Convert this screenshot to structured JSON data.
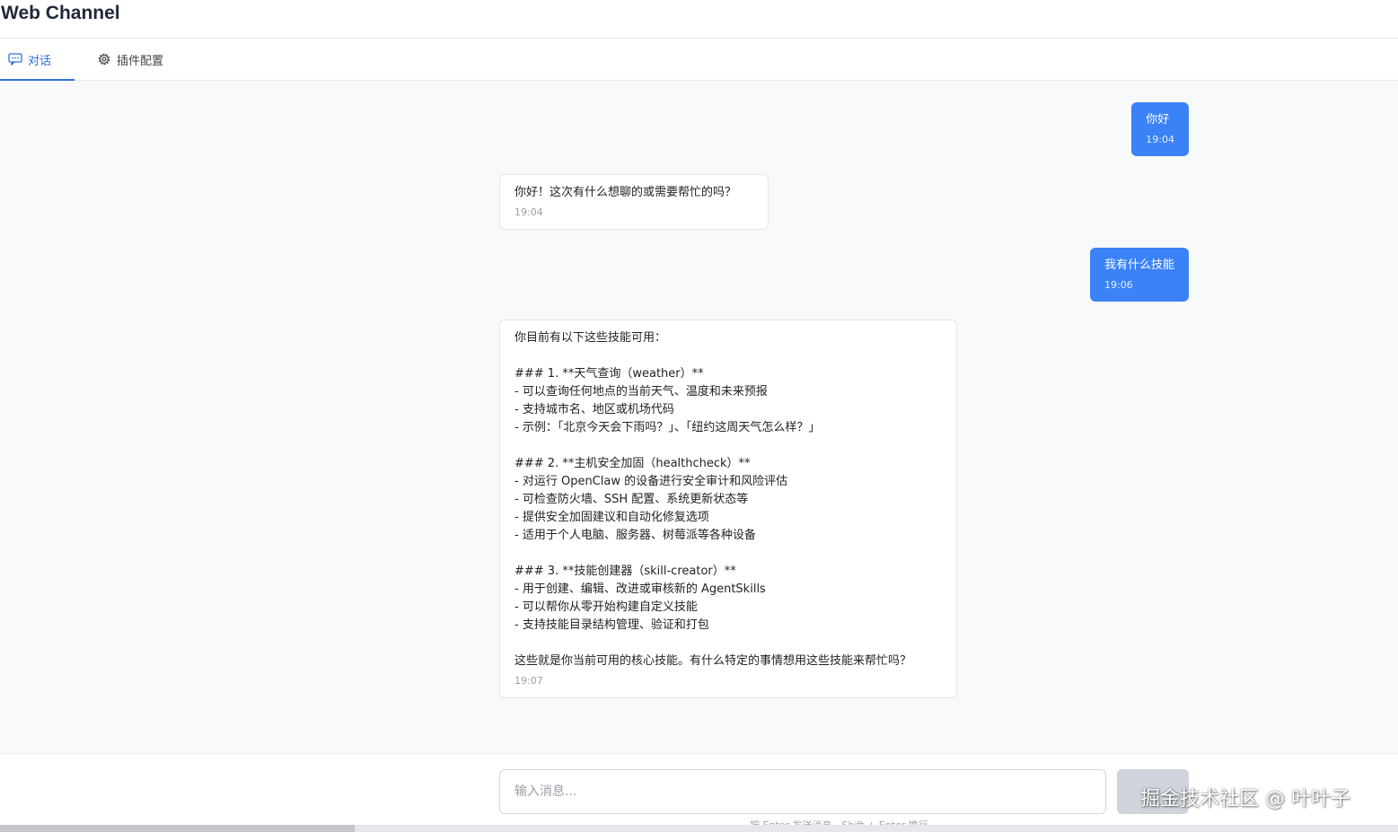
{
  "header": {
    "title": "Web Channel"
  },
  "tabs": [
    {
      "label": "对话",
      "icon": "chat-bubble-icon",
      "active": true
    },
    {
      "label": "插件配置",
      "icon": "gear-icon",
      "active": false
    }
  ],
  "messages": [
    {
      "role": "user",
      "text": "你好",
      "time": "19:04"
    },
    {
      "role": "assistant",
      "text": "你好！这次有什么想聊的或需要帮忙的吗？",
      "time": "19:04"
    },
    {
      "role": "user",
      "text": "我有什么技能",
      "time": "19:06"
    },
    {
      "role": "assistant",
      "text": "你目前有以下这些技能可用：\n\n### 1. **天气查询（weather）**\n- 可以查询任何地点的当前天气、温度和未来预报\n- 支持城市名、地区或机场代码\n- 示例：「北京今天会下雨吗？」、「纽约这周天气怎么样？」\n\n### 2. **主机安全加固（healthcheck）**\n- 对运行 OpenClaw 的设备进行安全审计和风险评估\n- 可检查防火墙、SSH 配置、系统更新状态等\n- 提供安全加固建议和自动化修复选项\n- 适用于个人电脑、服务器、树莓派等各种设备\n\n### 3. **技能创建器（skill-creator）**\n- 用于创建、编辑、改进或审核新的 AgentSkills\n- 可以帮你从零开始构建自定义技能\n- 支持技能目录结构管理、验证和打包\n\n这些就是你当前可用的核心技能。有什么特定的事情想用这些技能来帮忙吗？",
      "time": "19:07"
    }
  ],
  "composer": {
    "placeholder": "输入消息...",
    "hint": "按 Enter 发送消息，Shift + Enter 换行"
  },
  "watermark": "掘金技术社区 @ 叶叶子",
  "colors": {
    "accent": "#2f6fdb",
    "user_bubble": "#3b82f6",
    "send_disabled": "#cfd4dc"
  }
}
